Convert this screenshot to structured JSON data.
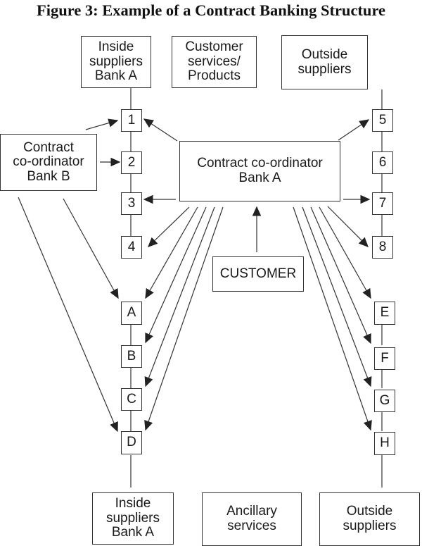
{
  "title": "Figure 3: Example of  a Contract Banking Structure",
  "boxes": {
    "inside_top": [
      "Inside",
      "suppliers",
      "Bank A"
    ],
    "customer_services": [
      "Customer",
      "services/",
      "Products"
    ],
    "outside_top": [
      "Outside",
      "suppliers"
    ],
    "coordinator_b": [
      "Contract",
      "co-ordinator",
      "Bank B"
    ],
    "coordinator_a": [
      "Contract co-ordinator",
      "Bank A"
    ],
    "customer": [
      "CUSTOMER"
    ],
    "inside_bottom": [
      "Inside",
      "suppliers",
      "Bank A"
    ],
    "ancillary": [
      "Ancillary",
      "services"
    ],
    "outside_bottom": [
      "Outside",
      "suppliers"
    ]
  },
  "nodes": {
    "left_numbers": [
      "1",
      "2",
      "3",
      "4"
    ],
    "right_numbers": [
      "5",
      "6",
      "7",
      "8"
    ],
    "left_letters": [
      "A",
      "B",
      "C",
      "D"
    ],
    "right_letters": [
      "E",
      "F",
      "G",
      "H"
    ]
  },
  "links": [
    {
      "from": "Contract co-ordinator Bank B",
      "to": "1"
    },
    {
      "from": "Contract co-ordinator Bank B",
      "to": "2"
    },
    {
      "from": "Contract co-ordinator Bank B",
      "to": "A"
    },
    {
      "from": "Contract co-ordinator Bank B",
      "to": "D"
    },
    {
      "from": "Contract co-ordinator Bank A",
      "to": "1"
    },
    {
      "from": "Contract co-ordinator Bank A",
      "to": "3"
    },
    {
      "from": "Contract co-ordinator Bank A",
      "to": "4"
    },
    {
      "from": "Contract co-ordinator Bank A",
      "to": "A"
    },
    {
      "from": "Contract co-ordinator Bank A",
      "to": "B"
    },
    {
      "from": "Contract co-ordinator Bank A",
      "to": "C"
    },
    {
      "from": "Contract co-ordinator Bank A",
      "to": "D"
    },
    {
      "from": "Contract co-ordinator Bank A",
      "to": "5"
    },
    {
      "from": "Contract co-ordinator Bank A",
      "to": "7"
    },
    {
      "from": "Contract co-ordinator Bank A",
      "to": "8"
    },
    {
      "from": "Contract co-ordinator Bank A",
      "to": "E"
    },
    {
      "from": "Contract co-ordinator Bank A",
      "to": "F"
    },
    {
      "from": "Contract co-ordinator Bank A",
      "to": "G"
    },
    {
      "from": "Contract co-ordinator Bank A",
      "to": "H"
    },
    {
      "from": "CUSTOMER",
      "to": "Contract co-ordinator Bank A"
    }
  ]
}
